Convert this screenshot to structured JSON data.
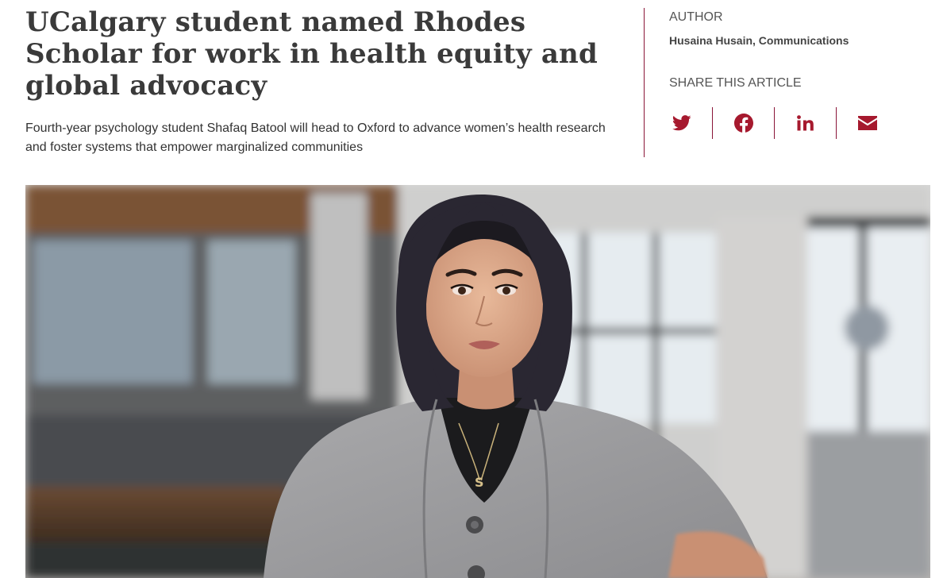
{
  "article": {
    "headline": "UCalgary student named Rhodes Scholar for work in health equity and global advocacy",
    "dek": "Fourth-year psychology student Shafaq Batool will head to Oxford to advance women’s health research and foster systems that empower marginalized communities"
  },
  "sidebar": {
    "author_label": "AUTHOR",
    "author_name": "Husaina Husain, Communications",
    "share_label": "SHARE THIS ARTICLE",
    "share_icons": [
      "twitter-icon",
      "facebook-icon",
      "linkedin-icon",
      "email-icon"
    ]
  },
  "hero_image": {
    "subject": "portrait photo"
  },
  "colors": {
    "accent": "#8a1538",
    "icon": "#a6192e",
    "headline": "#3a3a3a"
  }
}
